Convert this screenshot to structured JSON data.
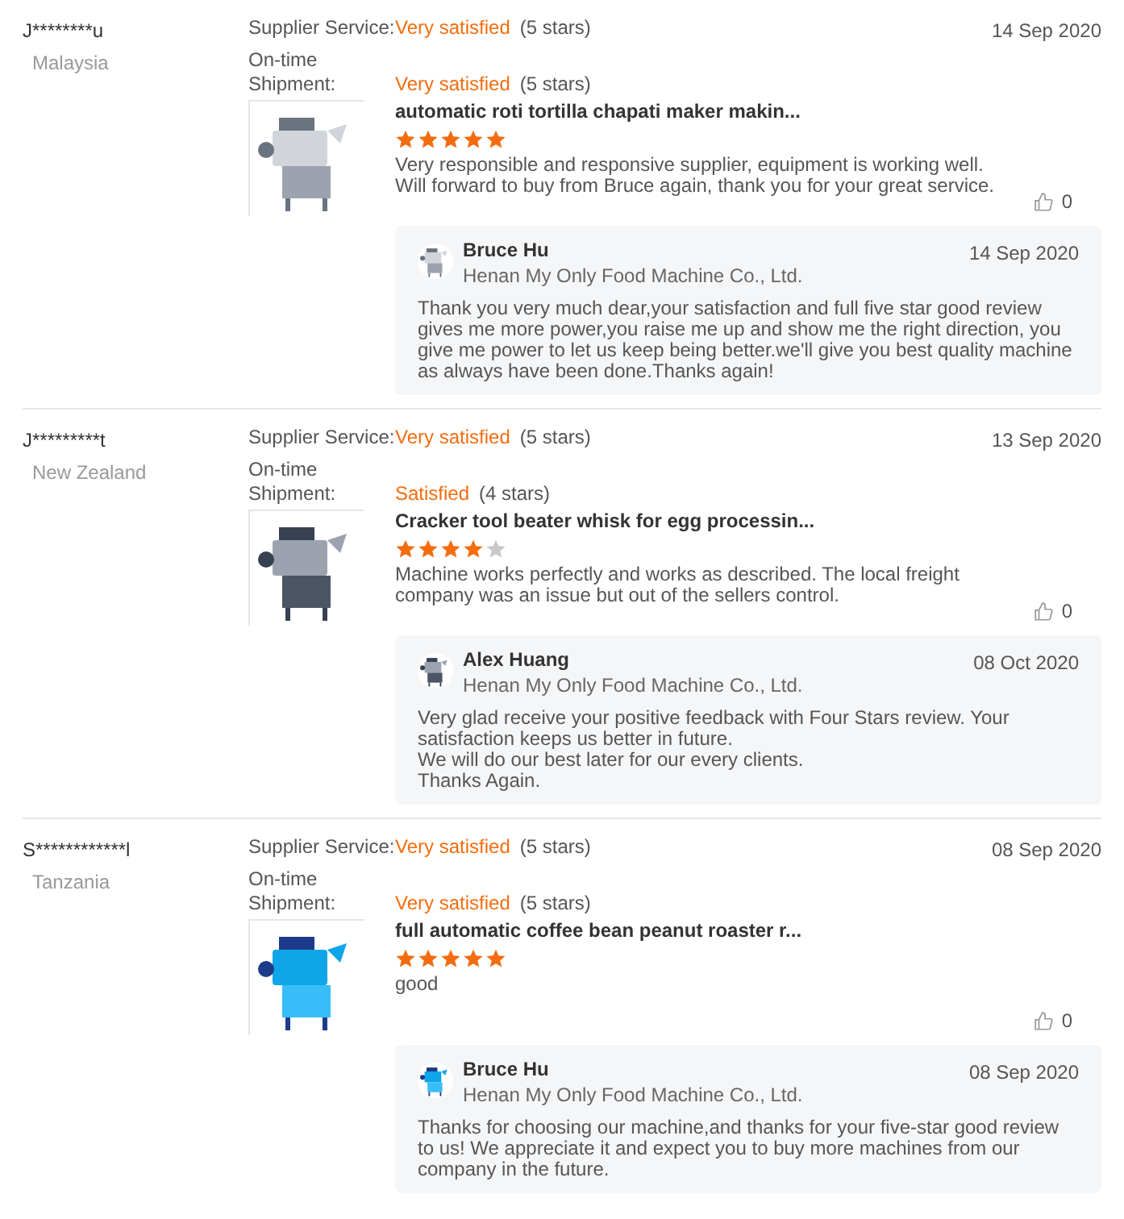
{
  "reviews": [
    {
      "buyer": "J********u",
      "country": "Malaysia",
      "date": "14 Sep 2020",
      "ratings": [
        {
          "label": "Supplier Service:",
          "value": "Very satisfied",
          "count": "(5 stars)"
        },
        {
          "label": "On-time Shipment:",
          "value": "Very satisfied",
          "count": "(5 stars)"
        }
      ],
      "product": {
        "title": "automatic roti tortilla chapati maker makin...",
        "stars": 5
      },
      "text": "Very responsible and responsive supplier, equipment is working well. Will forward to buy from Bruce again, thank you for your great service.",
      "likes": "0",
      "reply": {
        "name": "Bruce Hu",
        "company": "Henan My Only Food Machine Co., Ltd.",
        "date": "14 Sep 2020",
        "text": "Thank you very much dear,your satisfaction and full five star good review gives me more power,you raise me up and show me the right direction, you give me power to let us keep being better.we'll give you best quality machine as always have been done.Thanks again!"
      }
    },
    {
      "buyer": "J*********t",
      "country": "New Zealand",
      "date": "13 Sep 2020",
      "ratings": [
        {
          "label": "Supplier Service:",
          "value": "Very satisfied",
          "count": "(5 stars)"
        },
        {
          "label": "On-time Shipment:",
          "value": "Satisfied",
          "count": "(4 stars)"
        }
      ],
      "product": {
        "title": "Cracker tool beater whisk for egg processin...",
        "stars": 4
      },
      "text": "Machine works perfectly and works as described. The local freight company was an issue but out of the sellers control.",
      "likes": "0",
      "reply": {
        "name": "Alex Huang",
        "company": "Henan My Only Food Machine Co., Ltd.",
        "date": "08 Oct 2020",
        "text": "Very glad receive your positive feedback with Four Stars review. Your satisfaction keeps us better in future.\nWe will do our best later for our every clients.\nThanks Again."
      }
    },
    {
      "buyer": "S************l",
      "country": "Tanzania",
      "date": "08 Sep 2020",
      "ratings": [
        {
          "label": "Supplier Service:",
          "value": "Very satisfied",
          "count": "(5 stars)"
        },
        {
          "label": "On-time Shipment:",
          "value": "Very satisfied",
          "count": "(5 stars)"
        }
      ],
      "product": {
        "title": "full automatic coffee bean peanut roaster r...",
        "stars": 5
      },
      "text": "good",
      "likes": "0",
      "reply": {
        "name": "Bruce Hu",
        "company": "Henan My Only Food Machine Co., Ltd.",
        "date": "08 Sep 2020",
        "text": "Thanks for choosing our machine,and thanks for your five-star good review to us! We appreciate it and expect you to buy more machines from our company in the future."
      }
    }
  ]
}
